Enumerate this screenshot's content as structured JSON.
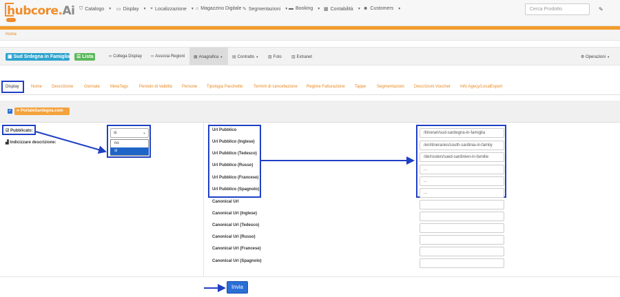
{
  "logo": {
    "text": "hubcore.",
    "ai": "Ai",
    "badge": ""
  },
  "nav": {
    "items": [
      {
        "label": "Catalogo",
        "icon": "tag-icon",
        "glyph": "🏷"
      },
      {
        "label": "Display",
        "icon": "monitor-icon",
        "glyph": "▭"
      },
      {
        "label": "Localizzazione",
        "icon": "map-pin-icon",
        "glyph": "⌖"
      },
      {
        "label": "Magazzino Digitale",
        "icon": "building-icon",
        "glyph": "⌂"
      },
      {
        "label": "Segmentazioni",
        "icon": "wand-icon",
        "glyph": "✎"
      },
      {
        "label": "Booking",
        "icon": "ticket-icon",
        "glyph": "▬"
      },
      {
        "label": "Contabilità",
        "icon": "grid-icon",
        "glyph": "▦"
      },
      {
        "label": "Customers",
        "icon": "user-icon",
        "glyph": "☻"
      }
    ],
    "search_placeholder": "Cerca Prodotto"
  },
  "breadcrumb": "Home",
  "toolbar": {
    "product_name": "Sud Srdegna in Famiglia",
    "list_label": "Lista",
    "items": [
      {
        "label": "Collega Display",
        "icon": "link-icon"
      },
      {
        "label": "Associa Regioni",
        "icon": "link-icon"
      },
      {
        "label": "Anagrafica",
        "icon": "table-icon"
      },
      {
        "label": "Contratto",
        "icon": "file-icon"
      },
      {
        "label": "Foto",
        "icon": "image-icon"
      },
      {
        "label": "Extranet",
        "icon": "server-icon"
      }
    ],
    "operazioni": "Operazioni"
  },
  "tabs": [
    "Display",
    "Nome",
    "Descrizione",
    "Giornate",
    "MetaTags",
    "Periodo di Validità",
    "Persone",
    "Tipologia Pacchetto",
    "Termini di cancellazione",
    "Regime Fatturazione",
    "Tappe",
    "Segmentazioni",
    "Descrizioni Voucher",
    "Info Agecy/LocalExpert"
  ],
  "site": {
    "checked": true,
    "name": "PortaleSardegna.com"
  },
  "form": {
    "pubblicato_label": "Pubblicato:",
    "indicizzare_label": "Indicizzare descrizione:",
    "select_value": "si",
    "options": [
      "no",
      "si"
    ],
    "selected_option": "si",
    "url_labels": [
      "Url Pubblico",
      "Url Pubblico (Inglese)",
      "Url Pubblico (Tedesco)",
      "Url Pubblico (Russo)",
      "Url Pubblico (Francese)",
      "Url Pubblico (Spagnolo)"
    ],
    "url_values": [
      "/itinerari/sud-sardegna-in-famiglia",
      "/en/itineraries/south-sardinia-in-family",
      "/de/routen/sued-sardinien-in-familie",
      "...",
      "...",
      "..."
    ],
    "canonical_labels": [
      "Canonical Url",
      "Canonical Url (Inglese)",
      "Canonical Url (Tedesco)",
      "Canonical Url (Russo)",
      "Canonical Url (Francese)",
      "Canonical Url (Spagnolo)"
    ],
    "canonical_values": [
      "",
      "",
      "",
      "",
      "",
      ""
    ],
    "submit_label": "Invia"
  },
  "colors": {
    "accent": "#f39c2a",
    "link": "#e8871e",
    "highlight": "#1f3fc4",
    "primary": "#2a6fd6"
  }
}
